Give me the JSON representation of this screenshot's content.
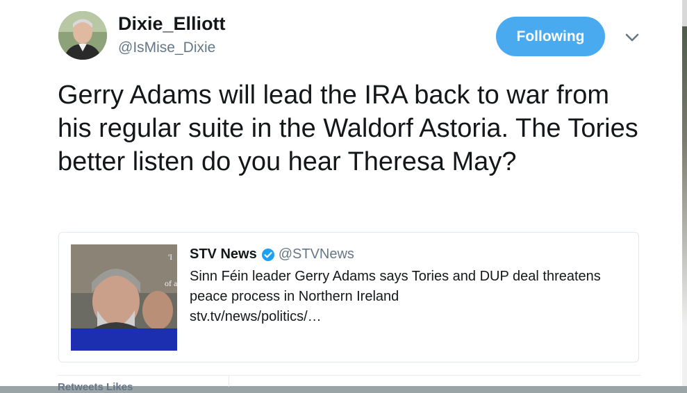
{
  "user": {
    "display_name": "Dixie_Elliott",
    "handle": "@IsMise_Dixie",
    "follow_label": "Following"
  },
  "tweet": {
    "text": "Gerry Adams will lead the IRA back to war from his regular suite in the Waldorf Astoria. The Tories better listen do you hear Theresa May?"
  },
  "quoted": {
    "name": "STV News",
    "handle": "@STVNews",
    "text": "Sinn Féin leader Gerry Adams says Tories and DUP deal threatens peace process in Northern Ireland",
    "link": "stv.tv/news/politics/…",
    "image_overlay_text": "'I of a"
  },
  "stats": {
    "label": "Retweets     Likes"
  },
  "colors": {
    "follow_button": "#4aaaf0",
    "verified_badge": "#1da1f2",
    "secondary_text": "#657786",
    "image_bar": "#1c2fb0"
  },
  "icons": {
    "caret": "chevron-down-icon",
    "verified": "verified-badge-icon"
  }
}
